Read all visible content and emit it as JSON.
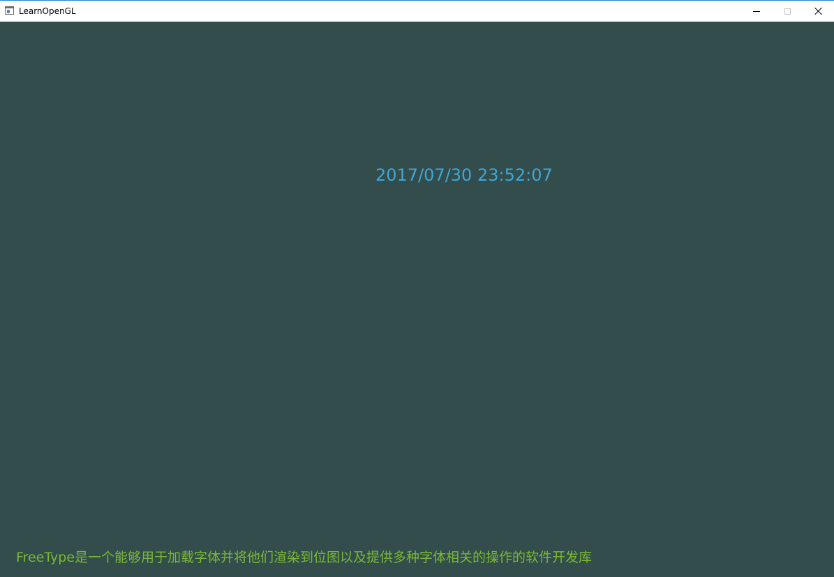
{
  "window": {
    "title": "LearnOpenGL",
    "app_icon": "window-app-icon",
    "controls": {
      "minimize_icon": "minimize-icon",
      "maximize_icon": "maximize-icon",
      "close_icon": "close-icon"
    }
  },
  "canvas": {
    "background_color": "#334d4d",
    "datetime": {
      "text": "2017/07/30 23:52:07",
      "color": "#3fa7d6"
    },
    "caption": {
      "text": "FreeType是一个能够用于加载字体并将他们渲染到位图以及提供多种字体相关的操作的软件开发库",
      "color": "#7ab834"
    }
  }
}
